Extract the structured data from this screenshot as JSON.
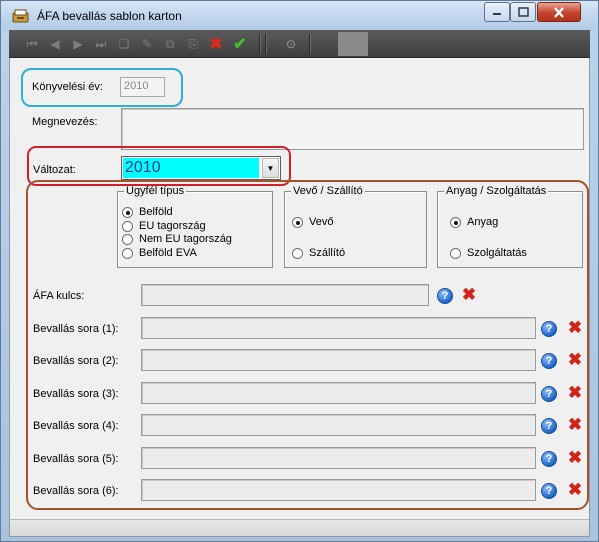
{
  "window": {
    "title": "ÁFA bevallás sablon karton"
  },
  "toolbar": {
    "icons": [
      "first-icon",
      "prev-icon",
      "next-icon",
      "last-icon",
      "new-icon",
      "edit-icon",
      "copy-icon",
      "paste-icon",
      "delete-icon",
      "save-icon",
      "info-icon"
    ]
  },
  "form": {
    "year_label": "Könyvelési év:",
    "year_value": "2010",
    "name_label": "Megnevezés:",
    "version_label": "Változat:",
    "version_value": "2010",
    "type_group": {
      "title": "Ügyfél típus",
      "options": [
        "Belföld",
        "EU tagország",
        "Nem EU tagország",
        "Belföld EVA"
      ],
      "selected": "Belföld"
    },
    "partner_group": {
      "title": "Vevő / Szállító",
      "options": [
        "Vevő",
        "Szállító"
      ],
      "selected": "Vevő"
    },
    "goods_group": {
      "title": "Anyag / Szolgáltatás",
      "options": [
        "Anyag",
        "Szolgáltatás"
      ],
      "selected": "Anyag"
    },
    "vat_label": "ÁFA kulcs:",
    "rows": [
      {
        "label": "Bevallás sora (1):"
      },
      {
        "label": "Bevallás sora (2):"
      },
      {
        "label": "Bevallás sora (3):"
      },
      {
        "label": "Bevallás sora (4):"
      },
      {
        "label": "Bevallás sora (5):"
      },
      {
        "label": "Bevallás sora (6):"
      }
    ]
  },
  "colors": {
    "highlight_blue": "#2eaedb",
    "highlight_red": "#d21f2a",
    "highlight_brown": "#a3522a",
    "selected_version_bg": "#00ffff"
  }
}
